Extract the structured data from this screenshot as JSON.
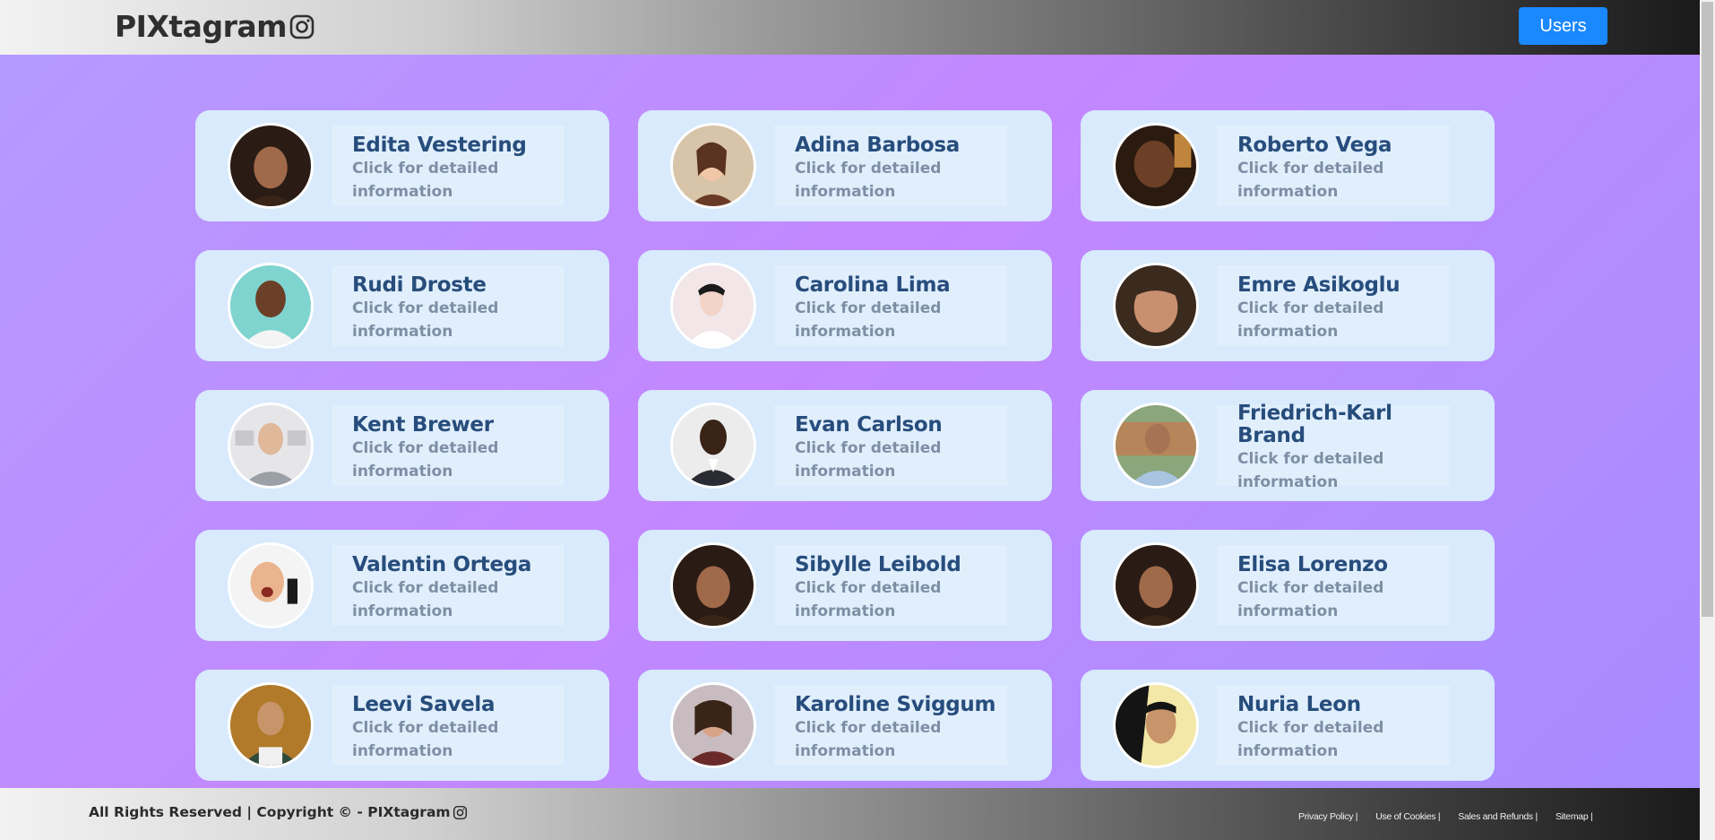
{
  "header": {
    "brand": "PIXtagram",
    "users_button": "Users"
  },
  "users": [
    {
      "name": "Edita Vestering",
      "subtitle": "Click for detailed information"
    },
    {
      "name": "Adina Barbosa",
      "subtitle": "Click for detailed information"
    },
    {
      "name": "Roberto Vega",
      "subtitle": "Click for detailed information"
    },
    {
      "name": "Rudi Droste",
      "subtitle": "Click for detailed information"
    },
    {
      "name": "Carolina Lima",
      "subtitle": "Click for detailed information"
    },
    {
      "name": "Emre Asikoglu",
      "subtitle": "Click for detailed information"
    },
    {
      "name": "Kent Brewer",
      "subtitle": "Click for detailed information"
    },
    {
      "name": "Evan Carlson",
      "subtitle": "Click for detailed information"
    },
    {
      "name": "Friedrich-Karl Brand",
      "subtitle": "Click for detailed information"
    },
    {
      "name": "Valentin Ortega",
      "subtitle": "Click for detailed information"
    },
    {
      "name": "Sibylle Leibold",
      "subtitle": "Click for detailed information"
    },
    {
      "name": "Elisa Lorenzo",
      "subtitle": "Click for detailed information"
    },
    {
      "name": "Leevi Savela",
      "subtitle": "Click for detailed information"
    },
    {
      "name": "Karoline Sviggum",
      "subtitle": "Click for detailed information"
    },
    {
      "name": "Nuria Leon",
      "subtitle": "Click for detailed information"
    }
  ],
  "footer": {
    "copyright": "All Rights Reserved | Copyright © - PIXtagram",
    "links": [
      "Privacy Policy |",
      "Use of Cookies |",
      "Sales and Refunds |",
      "Sitemap |"
    ]
  },
  "icons": {
    "brand_icon": "instagram-icon",
    "footer_icon": "instagram-icon"
  },
  "colors": {
    "users_button": "#1a88ff",
    "card_background": "#d8eafc",
    "name_text": "#274d7c",
    "subtitle_text": "#7e8fa5"
  }
}
